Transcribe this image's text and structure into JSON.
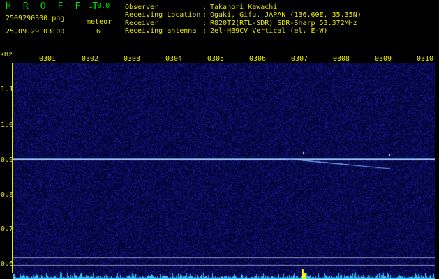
{
  "header": {
    "app_name": "H R O F F T",
    "version": "1.0.0",
    "filename": "2509290300.png",
    "datetime": "25.09.29 03:00",
    "meteor_label": "meteor",
    "meteor_count": "6"
  },
  "info": [
    {
      "label": "Observer",
      "value": "Takanori Kawachi"
    },
    {
      "label": "Receiving Location",
      "value": "Ogaki, Gifu, JAPAN (136.60E, 35.35N)"
    },
    {
      "label": "Receiver",
      "value": "R820T2(RTL-SDR) SDR-Sharp 53.372MHz"
    },
    {
      "label": "Receiving antenna",
      "value": "2el-HB9CV Vertical (el. E-W)"
    }
  ],
  "colon": ":",
  "axis": {
    "unit": "kHz",
    "time_ticks": [
      "0301",
      "0302",
      "0303",
      "0304",
      "0305",
      "0306",
      "0307",
      "0308",
      "0309",
      "0310"
    ],
    "freq_ticks": [
      "1.1",
      "1.0",
      "0.9",
      "0.8",
      "0.7",
      "0.6"
    ]
  },
  "colors": {
    "text_yellow": "#e8e800",
    "text_green": "#00e000",
    "noise_blue": "#1a1a7a",
    "signal_cyan": "#a0d8ff",
    "meteor_yellow": "#ffff00"
  }
}
